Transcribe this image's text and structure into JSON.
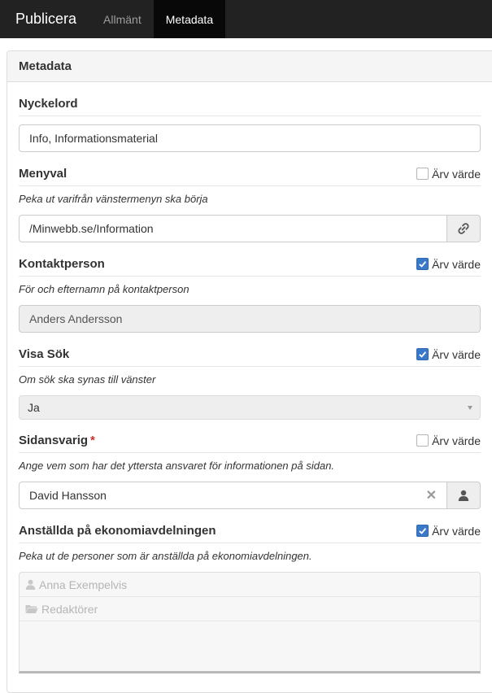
{
  "nav": {
    "brand": "Publicera",
    "tabs": [
      {
        "label": "Allmänt",
        "active": false
      },
      {
        "label": "Metadata",
        "active": true
      }
    ]
  },
  "panel": {
    "title": "Metadata"
  },
  "inherit_label": "Ärv värde",
  "fields": {
    "nyckelord": {
      "title": "Nyckelord",
      "value": "Info, Informationsmaterial"
    },
    "menyval": {
      "title": "Menyval",
      "inherit": false,
      "description": "Peka ut varifrån vänstermenyn ska börja",
      "value": "/Minwebb.se/Information",
      "addon_icon": "link-icon"
    },
    "kontaktperson": {
      "title": "Kontaktperson",
      "inherit": true,
      "description": "För och efternamn på kontaktperson",
      "value": "Anders Andersson"
    },
    "visa_sok": {
      "title": "Visa Sök",
      "inherit": true,
      "description": "Om sök ska synas till vänster",
      "value": "Ja"
    },
    "sidansvarig": {
      "title": "Sidansvarig",
      "required_mark": "*",
      "inherit": false,
      "description": "Ange vem som har det yttersta ansvaret för informationen på sidan.",
      "value": "David Hansson",
      "clear_icon": "clear-icon",
      "addon_icon": "user-icon"
    },
    "anstallda": {
      "title": "Anställda på ekonomiavdelningen",
      "inherit": true,
      "description": "Peka ut de personer som är anställda på ekonomiavdelningen.",
      "items": [
        {
          "label": "Anna Exempelvis",
          "icon": "user-icon"
        },
        {
          "label": "Redaktörer",
          "icon": "folder-icon"
        }
      ]
    }
  },
  "colors": {
    "navbar": "#222222",
    "active_tab": "#080808",
    "checkbox_checked": "#3a78c9",
    "required": "#c9302c"
  }
}
